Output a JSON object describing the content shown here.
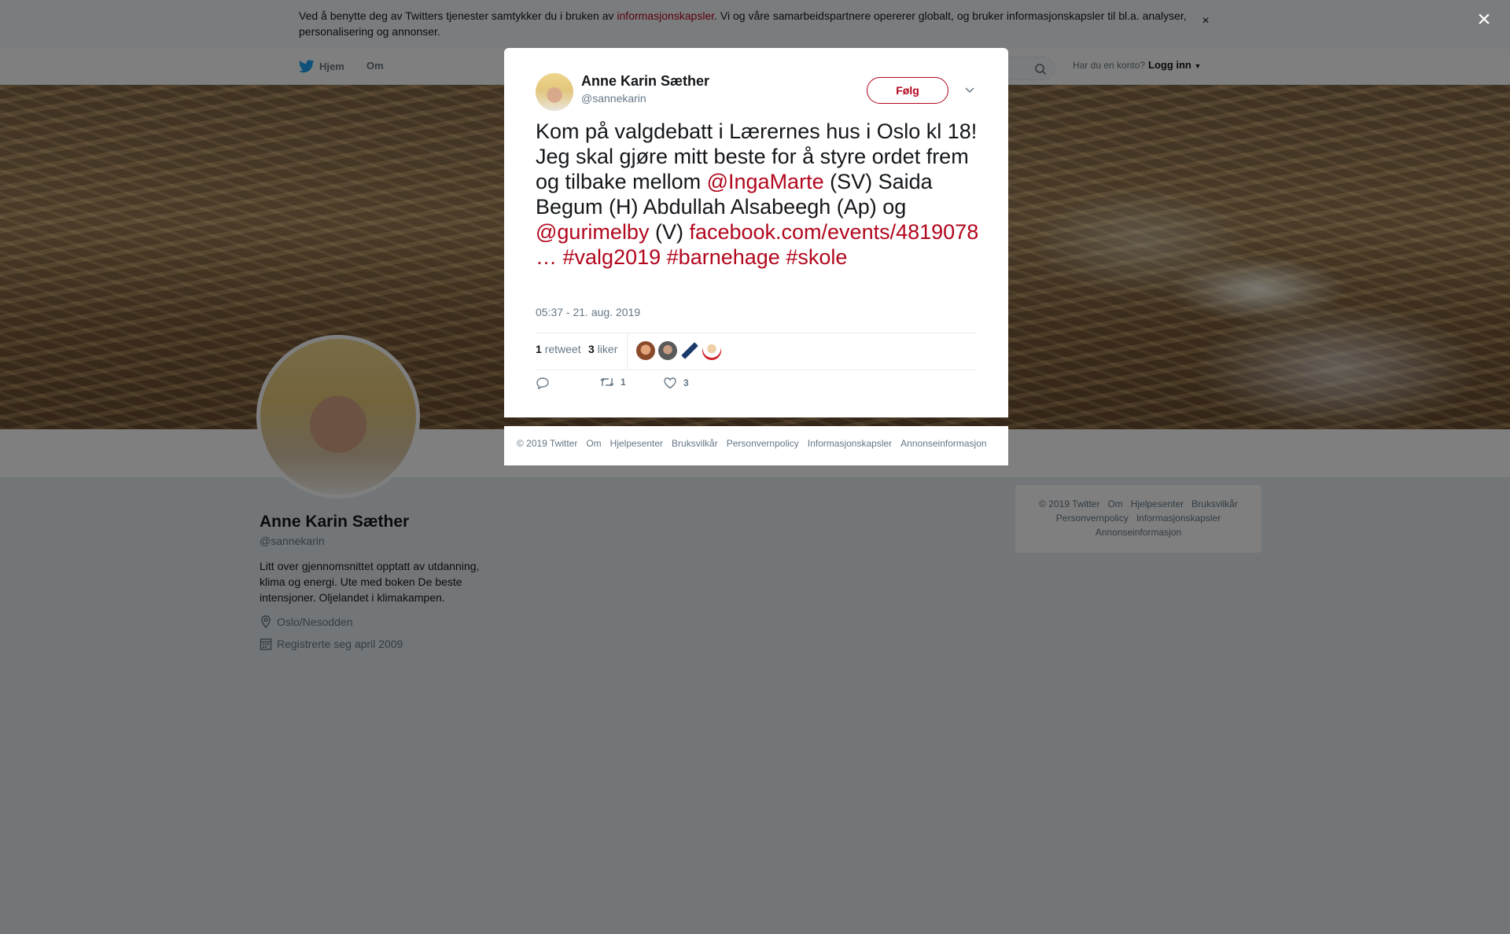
{
  "cookie": {
    "text_before": "Ved å benytte deg av Twitters tjenester samtykker du i bruken av ",
    "link": "informasjonskapsler",
    "text_after": ". Vi og våre samarbeidspartnere opererer globalt, og bruker informasjonskapsler til bl.a. analyser, personalisering og annonser.",
    "close": "×"
  },
  "nav": {
    "home": "Hjem",
    "about": "Om",
    "account_question": "Har du en konto?",
    "login": "Logg inn"
  },
  "profile": {
    "name": "Anne Karin Sæther",
    "handle": "@sannekarin",
    "bio": "Litt over gjennomsnittet opptatt av utdanning, klima og energi. Ute med boken De beste intensjoner. Oljelandet i klimakampen.",
    "location": "Oslo/Nesodden",
    "joined": "Registrerte seg april 2009"
  },
  "side_footer": {
    "row1": [
      "© 2019 Twitter",
      "Om",
      "Hjelpesenter",
      "Bruksvilkår"
    ],
    "row2": [
      "Personvernpolicy",
      "Informasjonskapsler"
    ],
    "row3": [
      "Annonseinformasjon"
    ]
  },
  "overlay": {
    "close": "×"
  },
  "tweet": {
    "name": "Anne Karin Sæther",
    "handle": "@sannekarin",
    "follow": "Følg",
    "t1": "Kom på valgdebatt i Lærernes hus i Oslo kl 18! Jeg skal gjøre mitt beste for å styre ordet frem og tilbake mellom ",
    "m1": "@IngaMarte",
    "t2": " (SV) Saida Begum (H) Abdullah Alsabeegh (Ap) og ",
    "m2": "@gurimelby",
    "t3": " (V) ",
    "link": "facebook.com/events/4819078 …",
    "h1": "#valg2019",
    "h2": "#barnehage",
    "h3": "#skole",
    "time": "05:37 - 21. aug. 2019",
    "retweets_count": "1",
    "retweets_label": "retweet",
    "likes_count": "3",
    "likes_label": "liker",
    "action_retweets": "1",
    "action_likes": "3"
  },
  "modal_footer": [
    "© 2019 Twitter",
    "Om",
    "Hjelpesenter",
    "Bruksvilkår",
    "Personvernpolicy",
    "Informasjonskapsler",
    "Annonseinformasjon"
  ],
  "colors": {
    "accent": "#b2071d",
    "muted": "#657786",
    "overlay": "rgba(0,0,0,0.5)"
  }
}
